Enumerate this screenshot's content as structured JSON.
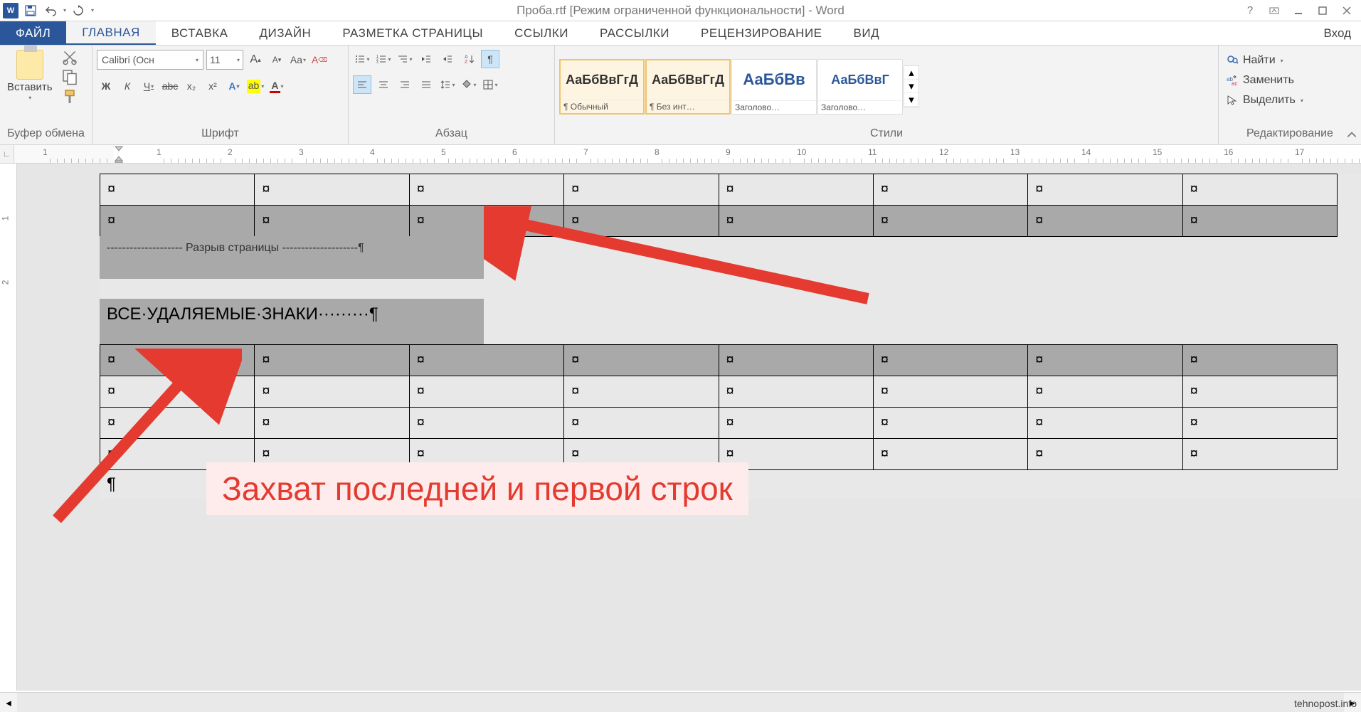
{
  "title": "Проба.rtf [Режим ограниченной функциональности] - Word",
  "login_label": "Вход",
  "tabs": {
    "file": "ФАЙЛ",
    "home": "ГЛАВНАЯ",
    "insert": "ВСТАВКА",
    "design": "ДИЗАЙН",
    "layout": "РАЗМЕТКА СТРАНИЦЫ",
    "refs": "ССЫЛКИ",
    "mail": "РАССЫЛКИ",
    "review": "РЕЦЕНЗИРОВАНИЕ",
    "view": "ВИД"
  },
  "ribbon": {
    "clipboard": {
      "label": "Буфер обмена",
      "paste": "Вставить"
    },
    "font": {
      "label": "Шрифт",
      "name": "Calibri (Осн",
      "size": "11",
      "bold": "Ж",
      "italic": "К",
      "underline": "Ч",
      "strike": "abc",
      "sub": "x₂",
      "sup": "x²",
      "case": "Aa",
      "clear": "A",
      "grow": "A",
      "shrink": "A"
    },
    "para": {
      "label": "Абзац"
    },
    "styles": {
      "label": "Стили",
      "preview_text": "АаБбВвГгД",
      "preview_text_blue": "АаБбВв",
      "preview_text_blue2": "АаБбВвГ",
      "items": [
        {
          "name": "¶ Обычный"
        },
        {
          "name": "¶ Без инт…"
        },
        {
          "name": "Заголово…"
        },
        {
          "name": "Заголово…"
        }
      ]
    },
    "edit": {
      "label": "Редактирование",
      "find": "Найти",
      "replace": "Заменить",
      "select": "Выделить"
    }
  },
  "ruler_numbers": [
    "1",
    "1",
    "2",
    "3",
    "4",
    "5",
    "6",
    "7",
    "8",
    "9",
    "10",
    "11",
    "12",
    "13",
    "14",
    "15",
    "16",
    "17"
  ],
  "doc": {
    "page_break": "Разрыв страницы",
    "heading": "ВСЕ·УДАЛЯЕМЫЕ·ЗНАКИ·········¶",
    "cell_mark": "¤"
  },
  "annotation": "Захват последней и первой строк",
  "watermark": "tehnopost.info"
}
